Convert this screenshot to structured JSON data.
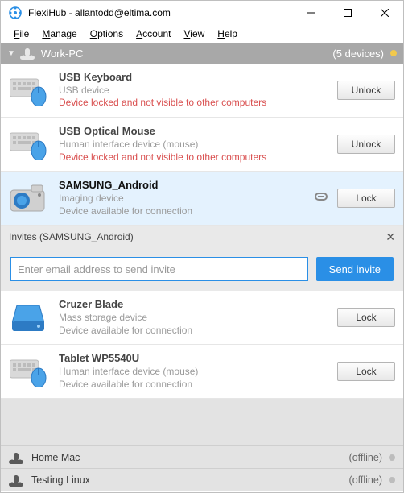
{
  "window": {
    "title": "FlexiHub - allantodd@eltima.com"
  },
  "menu": {
    "file": "File",
    "manage": "Manage",
    "options": "Options",
    "account": "Account",
    "view": "View",
    "help": "Help"
  },
  "node": {
    "name": "Work-PC",
    "count": "(5 devices)"
  },
  "devices": [
    {
      "name": "USB Keyboard",
      "type": "USB device",
      "status": "Device locked and not visible to other computers",
      "status_class": "red",
      "action": "Unlock",
      "icon": "keyboard-mouse"
    },
    {
      "name": "USB Optical Mouse",
      "type": "Human interface device (mouse)",
      "status": "Device locked and not visible to other computers",
      "status_class": "red",
      "action": "Unlock",
      "icon": "keyboard-mouse"
    },
    {
      "name": "SAMSUNG_Android",
      "type": "Imaging device",
      "status": "Device available for connection",
      "status_class": "grey",
      "action": "Lock",
      "icon": "camera",
      "selected": true,
      "link": true
    },
    {
      "name": "Cruzer Blade",
      "type": "Mass storage device",
      "status": "Device available for connection",
      "status_class": "grey",
      "action": "Lock",
      "icon": "drive"
    },
    {
      "name": "Tablet WP5540U",
      "type": "Human interface device (mouse)",
      "status": "Device available for connection",
      "status_class": "grey",
      "action": "Lock",
      "icon": "keyboard-mouse"
    }
  ],
  "invites": {
    "header": "Invites (SAMSUNG_Android)",
    "placeholder": "Enter email address to send invite",
    "send": "Send invite"
  },
  "offline_nodes": [
    {
      "name": "Home Mac",
      "status": "(offline)"
    },
    {
      "name": "Testing Linux",
      "status": "(offline)"
    }
  ]
}
